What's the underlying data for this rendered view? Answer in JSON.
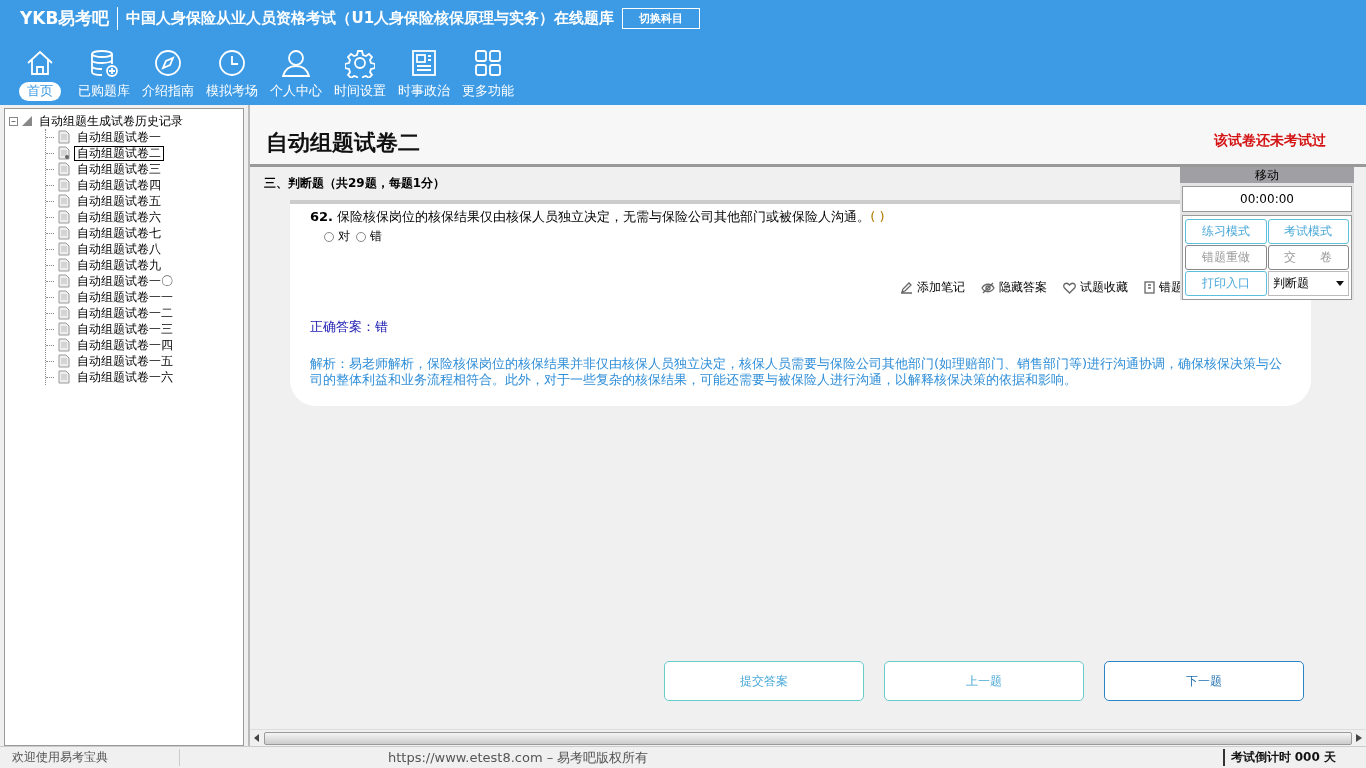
{
  "header": {
    "logo": "YKB易考吧",
    "title": "中国人身保险从业人员资格考试（U1人身保险核保原理与实务）在线题库",
    "switch_button": "切换科目"
  },
  "nav": [
    {
      "label": "首页",
      "selected": true
    },
    {
      "label": "已购题库",
      "selected": false
    },
    {
      "label": "介绍指南",
      "selected": false
    },
    {
      "label": "模拟考场",
      "selected": false
    },
    {
      "label": "个人中心",
      "selected": false
    },
    {
      "label": "时间设置",
      "selected": false
    },
    {
      "label": "时事政治",
      "selected": false
    },
    {
      "label": "更多功能",
      "selected": false
    }
  ],
  "tree": {
    "root": "自动组题生成试卷历史记录",
    "expanded": true,
    "children": [
      {
        "label": "自动组题试卷一",
        "selected": false
      },
      {
        "label": "自动组题试卷二",
        "selected": true
      },
      {
        "label": "自动组题试卷三",
        "selected": false
      },
      {
        "label": "自动组题试卷四",
        "selected": false
      },
      {
        "label": "自动组题试卷五",
        "selected": false
      },
      {
        "label": "自动组题试卷六",
        "selected": false
      },
      {
        "label": "自动组题试卷七",
        "selected": false
      },
      {
        "label": "自动组题试卷八",
        "selected": false
      },
      {
        "label": "自动组题试卷九",
        "selected": false
      },
      {
        "label": "自动组题试卷一〇",
        "selected": false
      },
      {
        "label": "自动组题试卷一一",
        "selected": false
      },
      {
        "label": "自动组题试卷一二",
        "selected": false
      },
      {
        "label": "自动组题试卷一三",
        "selected": false
      },
      {
        "label": "自动组题试卷一四",
        "selected": false
      },
      {
        "label": "自动组题试卷一五",
        "selected": false
      },
      {
        "label": "自动组题试卷一六",
        "selected": false
      }
    ]
  },
  "paper": {
    "title": "自动组题试卷二",
    "status": "该试卷还未考试过"
  },
  "section": "三、判断题（共29题，每题1分）",
  "question": {
    "number": "62.",
    "text": "保险核保岗位的核保结果仅由核保人员独立决定，无需与保险公司其他部门或被保险人沟通。",
    "blank": "( )",
    "options": [
      {
        "label": "对",
        "selected": false
      },
      {
        "label": "错",
        "selected": false
      }
    ]
  },
  "tools": [
    "添加笔记",
    "隐藏答案",
    "试题收藏",
    "错题"
  ],
  "answer": "正确答案：错",
  "analysis": "解析：易老师解析，保险核保岗位的核保结果并非仅由核保人员独立决定，核保人员需要与保险公司其他部门(如理赔部门、销售部门等)进行沟通协调，确保核保决策与公司的整体利益和业务流程相符合。此外，对于一些复杂的核保结果，可能还需要与被保险人进行沟通，以解释核保决策的依据和影响。",
  "panel": {
    "title": "移动",
    "timer": "00:00:00",
    "buttons": [
      {
        "label": "练习模式",
        "kind": "active"
      },
      {
        "label": "考试模式",
        "kind": "active"
      },
      {
        "label": "错题重做",
        "kind": "muted"
      },
      {
        "label": "交　　卷",
        "kind": "muted"
      },
      {
        "label": "打印入口",
        "kind": "active"
      }
    ],
    "select": "判断题"
  },
  "actions": [
    "提交答案",
    "上一题",
    "下一题"
  ],
  "status_bar": {
    "welcome": "欢迎使用易考宝典",
    "copyright": "https://www.etest8.com – 易考吧版权所有",
    "countdown": "考试倒计时 000 天"
  }
}
